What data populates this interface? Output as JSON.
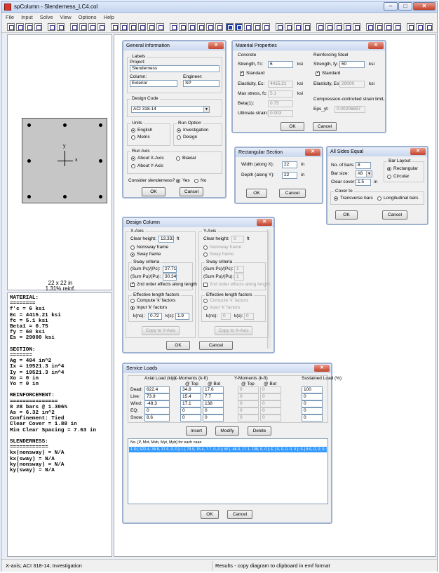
{
  "window": {
    "title": "spColumn - Slenderness_LC4.col",
    "minimize": "–",
    "maximize": "□",
    "close": "✕"
  },
  "menu": [
    "File",
    "Input",
    "Solve",
    "View",
    "Options",
    "Help"
  ],
  "section_view": {
    "axis_y": "y",
    "axis_x": "x",
    "size_label": "22 x 22 in",
    "reinf_label": "1.31% reinf."
  },
  "results_text": "MATERIAL:\n========\nf'c = 6 ksi\nEc = 4415.21 ksi\nfc = 5.1 ksi\nBeta1 = 0.75\nfy = 60 ksi\nEs = 29000 ksi\n\nSECTION:\n=======\nAg = 484 in^2\nIx = 19521.3 in^4\nIy = 19521.3 in^4\nXo = 0 in\nYo = 0 in\n\nREINFORCEMENT:\n===============\n8 #8 bars @ 1.306%\nAs = 6.32 in^2\nConfinement: Tied\nClear Cover = 1.88 in\nMin Clear Spacing = 7.63 in\n\nSLENDERNESS:\n============\nkx(nonsway) = N/A\nkx(sway) = N/A\nky(nonsway) = N/A\nky(sway) = N/A",
  "status": {
    "left": "X-axis; ACI 318-14; Investigation",
    "right": "Results - copy diagram to clipboard in emf format"
  },
  "general_info": {
    "title": "General Information",
    "labels_group": "Labels",
    "project_label": "Project:",
    "project_value": "Slenderness",
    "column_label": "Column:",
    "column_value": "Exterior",
    "engineer_label": "Engineer:",
    "engineer_value": "SP",
    "design_code_group": "Design Code",
    "design_code_value": "ACI 318-14",
    "units_group": "Units",
    "units_english": "English",
    "units_metric": "Metric",
    "run_option_group": "Run Option",
    "run_investigation": "Investigation",
    "run_design": "Design",
    "run_axis_group": "Run Axis",
    "about_x": "About X-Axis",
    "biaxial": "Biaxial",
    "about_y": "About Y-Axis",
    "slenderness_question": "Consider slenderness?",
    "yes": "Yes",
    "no": "No",
    "ok": "OK",
    "cancel": "Cancel"
  },
  "material": {
    "title": "Material Properties",
    "concrete_group": "Concrete",
    "fc_label": "Strength, f'c:",
    "fc_value": "6",
    "fc_unit": "ksi",
    "standard": "Standard",
    "ec_label": "Elasticity, Ec:",
    "ec_value": "4415.21",
    "ec_unit": "ksi",
    "maxstress_label": "Max stress, fc:",
    "maxstress_value": "5.1",
    "maxstress_unit": "ksi",
    "beta_label": "Beta(1):",
    "beta_value": "0.75",
    "ultstrain_label": "Ultimate strain:",
    "ultstrain_value": "0.003",
    "steel_group": "Reinforcing Steel",
    "fy_label": "Strength, fy:",
    "fy_value": "60",
    "fy_unit": "ksi",
    "steel_standard": "Standard",
    "es_label": "Elasticity, Es:",
    "es_value": "29000",
    "es_unit": "ksi",
    "strain_limit_note": "Compression-controlled strain limit,",
    "epsyt_label": "Eps_yt:",
    "epsyt_value": "0.00206897",
    "ok": "OK",
    "cancel": "Cancel"
  },
  "rect_section": {
    "title": "Rectangular Section",
    "width_label": "Width (along X):",
    "width_value": "22",
    "width_unit": "in",
    "depth_label": "Depth (along Y):",
    "depth_value": "22",
    "depth_unit": "in",
    "ok": "OK",
    "cancel": "Cancel"
  },
  "all_sides": {
    "title": "All Sides Equal",
    "nbars_label": "No. of bars:",
    "nbars_value": "8",
    "barsize_label": "Bar size:",
    "barsize_value": "#8",
    "cover_label": "Clear cover:",
    "cover_value": "1.5",
    "cover_unit": "in",
    "layout_group": "Bar Layout",
    "rectangular": "Rectangular",
    "circular": "Circular",
    "coverto_group": "Cover to",
    "transverse": "Transverse bars",
    "longitudinal": "Longitudinal bars",
    "ok": "OK",
    "cancel": "Cancel"
  },
  "design_column": {
    "title": "Design Column",
    "xaxis_group": "X-Axis",
    "yaxis_group": "Y-Axis",
    "clear_height_label": "Clear height:",
    "x_clear_height": "13.333",
    "y_clear_height": "0",
    "ft": "ft",
    "nonsway": "Nonsway frame",
    "sway": "Sway frame",
    "sway_criteria_group": "Sway criteria",
    "sum_pc_label": "(Sum Pc)/(Pc):",
    "x_sum_pc": "27.71",
    "y_sum_pc": "1",
    "sum_pu_label": "(Sum Pu)/(Pu):",
    "x_sum_pu": "30.34",
    "y_sum_pu": "1",
    "second_order": "2nd order effects along length",
    "eff_len_group": "Effective length factors",
    "compute_k": "Compute 'k' factors",
    "input_k": "Input 'k' factors",
    "k_ns_label": "k(ns):",
    "x_k_ns": "0.72",
    "y_k_ns": "0",
    "k_s_label": "k(s):",
    "x_k_s": "1.9",
    "y_k_s": "0",
    "copy_to_y": "Copy to Y-Axis",
    "copy_to_x": "Copy to X-Axis",
    "ok": "OK",
    "cancel": "Cancel"
  },
  "service_loads": {
    "title": "Service Loads",
    "col_axial": "Axial Load (kip)",
    "col_xmom": "X-Moments (k-ft)",
    "col_ymom": "Y-Moments (k-ft)",
    "col_sust": "Sustained Load (%)",
    "at_top": "@ Top",
    "at_bot": "@ Bot",
    "rows": [
      {
        "name": "Dead:",
        "axial": "622.4",
        "xtop": "34.8",
        "xbot": "17.6",
        "ytop": "0",
        "ybot": "0",
        "sust": "100"
      },
      {
        "name": "Live:",
        "axial": "73.9",
        "xtop": "15.4",
        "xbot": "7.7",
        "ytop": "0",
        "ybot": "0",
        "sust": "0"
      },
      {
        "name": "Wind:",
        "axial": "-48.3",
        "xtop": "17.1",
        "xbot": "138",
        "ytop": "0",
        "ybot": "0",
        "sust": "0"
      },
      {
        "name": "EQ:",
        "axial": "0",
        "xtop": "0",
        "xbot": "0",
        "ytop": "0",
        "ybot": "0",
        "sust": "0"
      },
      {
        "name": "Snow:",
        "axial": "8.6",
        "xtop": "0",
        "xbot": "0",
        "ytop": "0",
        "ybot": "0",
        "sust": "0"
      }
    ],
    "insert": "Insert",
    "modify": "Modify",
    "delete": "Delete",
    "list_header": "No. [P, Mxt, Mxb, Myt, Myb] for each case",
    "list_row": "1   D [ 622.4, 34.8, 17.6, 0, 0 ]; L [ 73.9, 15.4, 7.7, 0, 0 ]; W [ -48.3, 17.1, 138, 0, 0 ]; E [ 0, 0, 0, 0, 0 ]; S [ 8.6, 0, 0, 0, 0 ]",
    "ok": "OK",
    "cancel": "Cancel"
  }
}
